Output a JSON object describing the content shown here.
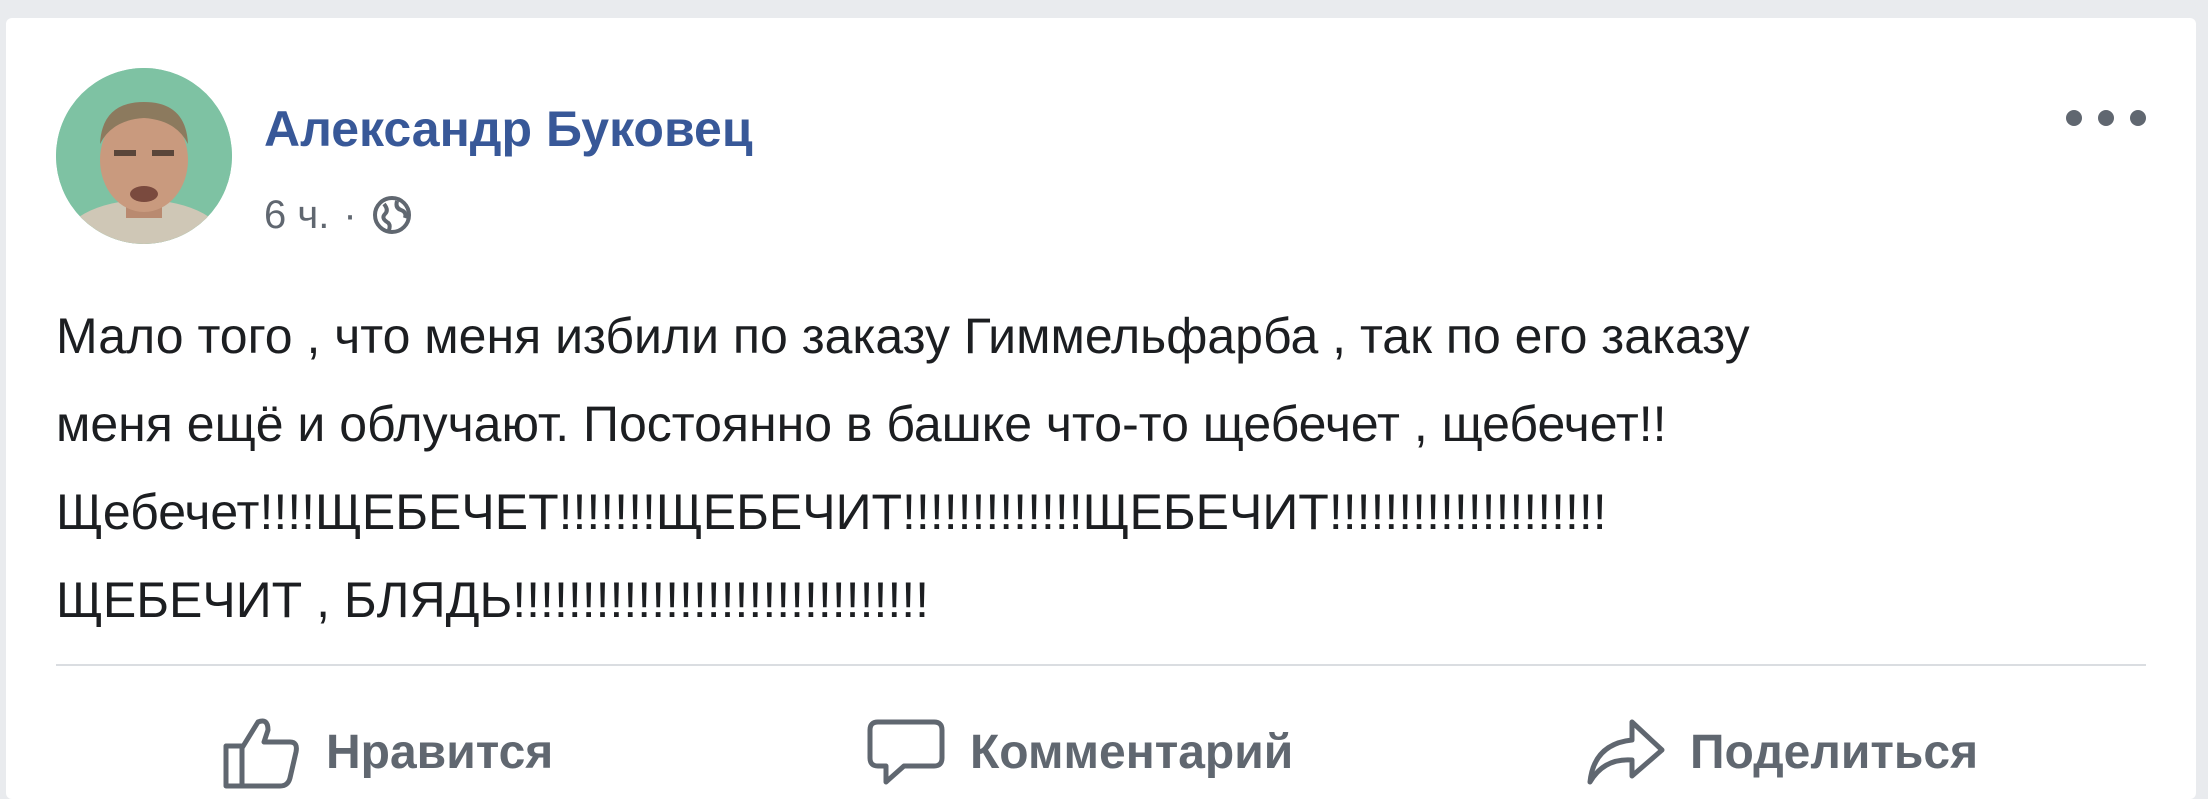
{
  "post": {
    "author": "Александр Буковец",
    "time": "6 ч.",
    "separator": "·",
    "privacy_icon": "globe-icon",
    "more_icon": "more-options-icon",
    "text_lines": [
      "Мало того , что меня избили по заказу Гиммельфарба , так по его заказу",
      "меня ещё и облучают. Постоянно в башке что-то щебечет , щебечет!!",
      "Щебечет!!!!ЩЕБЕЧЕТ!!!!!!!ЩЕБЕЧИТ!!!!!!!!!!!!!ЩЕБЕЧИТ!!!!!!!!!!!!!!!!!!!!",
      "ЩЕБЕЧИТ , БЛЯДЬ!!!!!!!!!!!!!!!!!!!!!!!!!!!!!!"
    ]
  },
  "actions": {
    "like": {
      "label": "Нравится",
      "icon": "thumbs-up-icon"
    },
    "comment": {
      "label": "Комментарий",
      "icon": "comment-icon"
    },
    "share": {
      "label": "Поделиться",
      "icon": "share-icon"
    }
  },
  "colors": {
    "author_link": "#385898",
    "secondary_text": "#606770",
    "body_text": "#1c1e21",
    "page_background": "#e9ebee"
  }
}
